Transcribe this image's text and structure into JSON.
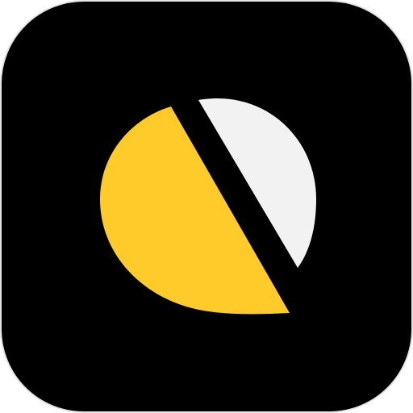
{
  "icon": {
    "name": "app-icon",
    "glyph": "split-speech-bubble-logo",
    "colors": {
      "background": "#000000",
      "left_shape": "#FFCB2B",
      "right_shape": "#F2F2F2"
    }
  }
}
